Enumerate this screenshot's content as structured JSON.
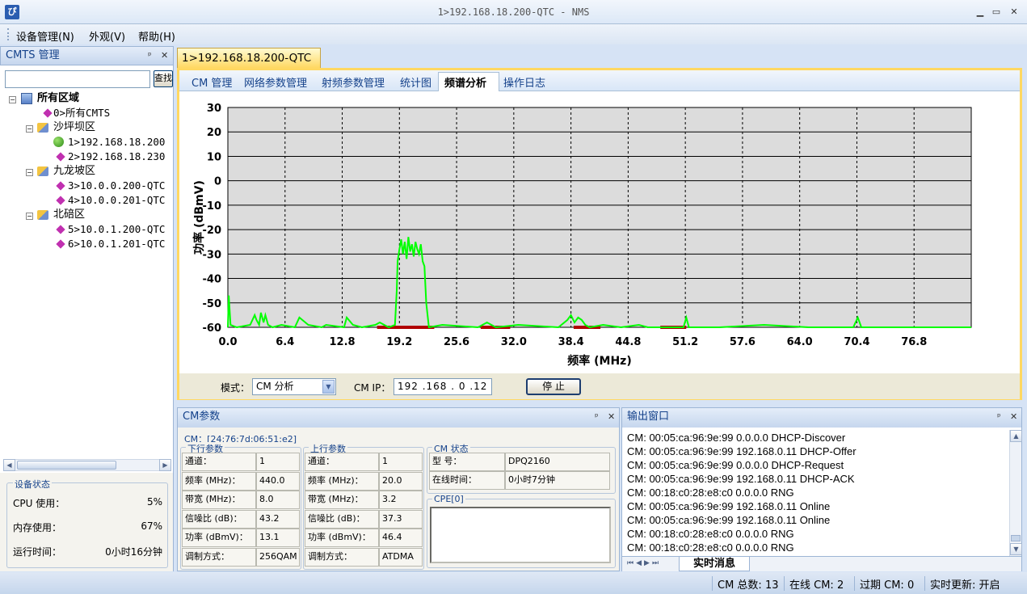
{
  "window": {
    "title": "1>192.168.18.200-QTC - NMS",
    "icon_text": "ぴ"
  },
  "menu": [
    {
      "label": "设备管理(N)"
    },
    {
      "label": "外观(V)"
    },
    {
      "label": "帮助(H)"
    }
  ],
  "left_pane": {
    "title": "CMTS 管理",
    "search_button": "查找",
    "search_value": "",
    "tree": {
      "root": "所有区域",
      "all_cmts": "0>所有CMTS",
      "groups": [
        {
          "name": "沙坪坝区",
          "items": [
            "1>192.168.18.200",
            "2>192.168.18.230"
          ]
        },
        {
          "name": "九龙坡区",
          "items": [
            "3>10.0.0.200-QTC",
            "4>10.0.0.201-QTC"
          ]
        },
        {
          "name": "北碚区",
          "items": [
            "5>10.0.1.200-QTC",
            "6>10.0.1.201-QTC"
          ]
        }
      ]
    },
    "status": {
      "title": "设备状态",
      "cpu_label": "CPU 使用：",
      "cpu_value": "5%",
      "mem_label": "内存使用：",
      "mem_value": "67%",
      "uptime_label": "运行时间：",
      "uptime_value": "0小时16分钟"
    }
  },
  "doc_tab": "1>192.168.18.200-QTC",
  "subtabs": [
    "CM 管理",
    "网络参数管理",
    "射频参数管理",
    "统计图",
    "频谱分析",
    "操作日志"
  ],
  "active_subtab": "频谱分析",
  "chart_data": {
    "type": "line",
    "xlabel": "频率 (MHz)",
    "ylabel": "功率 (dBmV)",
    "xlim": [
      0,
      83.2
    ],
    "ylim": [
      -60,
      30
    ],
    "x_ticks": [
      "0.0",
      "6.4",
      "12.8",
      "19.2",
      "25.6",
      "32.0",
      "38.4",
      "44.8",
      "51.2",
      "57.6",
      "64.0",
      "70.4",
      "76.8"
    ],
    "y_ticks": [
      "30",
      "20",
      "10",
      "0",
      "-10",
      "-20",
      "-30",
      "-40",
      "-50",
      "-60"
    ],
    "grid": true,
    "line_color": "#00ff00",
    "series": [
      {
        "x": [
          0.0,
          0.1,
          0.3,
          1.0,
          2.5,
          3.0,
          3.2,
          3.5,
          3.7,
          4.0,
          4.2,
          4.5,
          5.0,
          6.0,
          7.5,
          8.0,
          9.0,
          10.5,
          11.0,
          13.0,
          13.3,
          14.0,
          15.0,
          16.5,
          17.0,
          18.0,
          18.7,
          18.9,
          19.0,
          19.2,
          19.4,
          19.6,
          19.8,
          20.0,
          20.2,
          20.4,
          20.6,
          20.8,
          21.0,
          21.2,
          21.4,
          21.6,
          21.8,
          22.0,
          22.2,
          22.5,
          24.0,
          28.0,
          29.0,
          30.0,
          32.5,
          37.0,
          38.0,
          38.4,
          38.8,
          39.2,
          39.6,
          40.0,
          40.5,
          42.0,
          44.0,
          46.0,
          47.0,
          51.0,
          51.3,
          51.6,
          55.0,
          60.0,
          65.0,
          70.0,
          70.5,
          70.9,
          75.0,
          80.0,
          83.2
        ],
        "y": [
          -60,
          -47,
          -59,
          -60,
          -59,
          -55,
          -57,
          -59,
          -54,
          -58,
          -55,
          -59,
          -60,
          -59,
          -60,
          -56,
          -59,
          -60,
          -59,
          -60,
          -56,
          -59,
          -60,
          -59,
          -58,
          -60,
          -59,
          -45,
          -33,
          -28,
          -24,
          -30,
          -25,
          -32,
          -23,
          -29,
          -26,
          -31,
          -25,
          -28,
          -30,
          -26,
          -33,
          -35,
          -50,
          -60,
          -59,
          -60,
          -58,
          -60,
          -59,
          -60,
          -57,
          -55,
          -58,
          -56,
          -57,
          -59,
          -60,
          -59,
          -60,
          -59,
          -60,
          -60,
          -56,
          -60,
          -60,
          -59,
          -60,
          -60,
          -56,
          -60,
          -60,
          -60,
          -60
        ]
      }
    ],
    "red_bands": [
      [
        16.7,
        23.1
      ],
      [
        28.3,
        31.6
      ],
      [
        38.7,
        41.7
      ],
      [
        48.4,
        51.3
      ]
    ]
  },
  "controls": {
    "mode_label": "模式：",
    "mode_value": "CM 分析",
    "cmip_label": "CM IP：",
    "cmip_value": "192 .168 . 0 .12",
    "stop_button": "停 止"
  },
  "cm_params": {
    "title": "CM参数",
    "cm_mac_label": "CM：[24:76:7d:06:51:e2]",
    "downstream": {
      "title": "下行参数",
      "rows": [
        {
          "label": "通道：",
          "value": "1"
        },
        {
          "label": "频率 (MHz)：",
          "value": "440.0"
        },
        {
          "label": "带宽 (MHz)：",
          "value": "8.0"
        },
        {
          "label": "信噪比 (dB)：",
          "value": "43.2"
        },
        {
          "label": "功率 (dBmV)：",
          "value": "13.1"
        },
        {
          "label": "调制方式：",
          "value": "256QAM"
        }
      ]
    },
    "upstream": {
      "title": "上行参数",
      "rows": [
        {
          "label": "通道：",
          "value": "1"
        },
        {
          "label": "频率 (MHz)：",
          "value": "20.0"
        },
        {
          "label": "带宽 (MHz)：",
          "value": "3.2"
        },
        {
          "label": "信噪比 (dB)：",
          "value": "37.3"
        },
        {
          "label": "功率 (dBmV)：",
          "value": "46.4"
        },
        {
          "label": "调制方式：",
          "value": "ATDMA"
        }
      ]
    },
    "cm_status": {
      "title": "CM 状态",
      "model_label": "型  号：",
      "model_value": "DPQ2160",
      "online_label": "在线时间：",
      "online_value": "0小时7分钟"
    },
    "cpe_title": "CPE[0]"
  },
  "output": {
    "title": "输出窗口",
    "lines": [
      "CM: 00:05:ca:96:9e:99  0.0.0.0  DHCP-Discover",
      "CM: 00:05:ca:96:9e:99  192.168.0.11  DHCP-Offer",
      "CM: 00:05:ca:96:9e:99  0.0.0.0  DHCP-Request",
      "CM: 00:05:ca:96:9e:99  192.168.0.11  DHCP-ACK",
      "CM: 00:18:c0:28:e8:c0  0.0.0.0  RNG",
      "CM: 00:05:ca:96:9e:99  192.168.0.11  Online",
      "CM: 00:05:ca:96:9e:99  192.168.0.11  Online",
      "CM: 00:18:c0:28:e8:c0  0.0.0.0  RNG",
      "CM: 00:18:c0:28:e8:c0  0.0.0.0  RNG"
    ],
    "tab": "实时消息"
  },
  "statusbar": {
    "total": "CM 总数: 13",
    "online": "在线 CM: 2",
    "expired": "过期 CM: 0",
    "realtime": "实时更新: 开启"
  }
}
